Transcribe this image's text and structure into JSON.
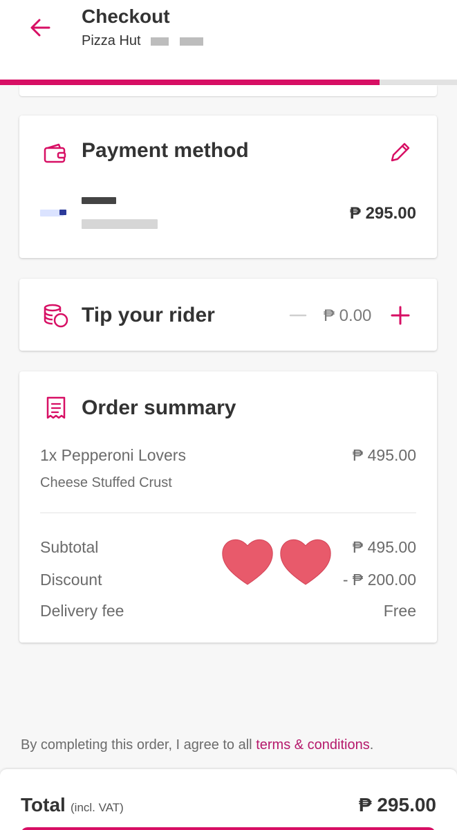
{
  "header": {
    "title": "Checkout",
    "restaurant": "Pizza Hut",
    "progress_fraction": 0.83
  },
  "payment": {
    "title": "Payment method",
    "amount": "₱ 295.00"
  },
  "tip": {
    "title": "Tip your rider",
    "amount": "₱ 0.00"
  },
  "order_summary": {
    "title": "Order summary",
    "item_name": "1x Pepperoni Lovers",
    "item_price": "₱ 495.00",
    "item_option": "Cheese Stuffed Crust",
    "subtotal_label": "Subtotal",
    "subtotal_value": "₱ 495.00",
    "discount_label": "Discount",
    "discount_value": "- ₱ 200.00",
    "delivery_label": "Delivery fee",
    "delivery_value": "Free"
  },
  "terms": {
    "text": "By completing this order, I agree to all ",
    "link": "terms & conditions",
    "suffix": "."
  },
  "footer": {
    "total_label": "Total",
    "vat_label": "(incl. VAT)",
    "total_value": "₱ 295.00"
  },
  "colors": {
    "brand": "#d70f64",
    "sticker_heart": "#e85a6b"
  },
  "icons": [
    "back-arrow-icon",
    "wallet-icon",
    "pencil-icon",
    "coins-icon",
    "minus-icon",
    "plus-icon",
    "receipt-icon",
    "heart-sticker-icon"
  ]
}
